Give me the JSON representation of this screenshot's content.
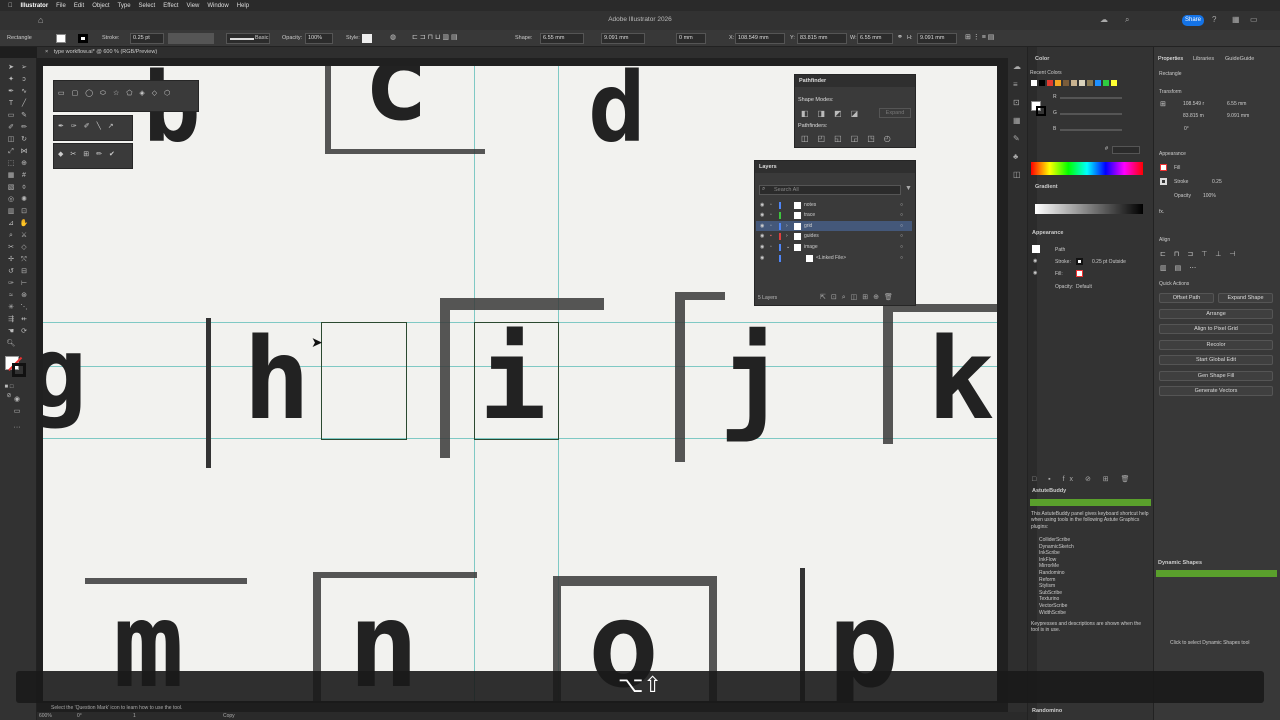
{
  "menubar": {
    "apple": "",
    "items": [
      "Illustrator",
      "File",
      "Edit",
      "Object",
      "Type",
      "Select",
      "Effect",
      "View",
      "Window",
      "Help"
    ]
  },
  "window": {
    "title": "Adobe Illustrator 2026",
    "share": "Share"
  },
  "control": {
    "object_type": "Rectangle",
    "stroke_label": "Stroke:",
    "stroke_value": "0.25 pt",
    "brush": "Basic",
    "opacity_label": "Opacity:",
    "opacity_value": "100%",
    "style_label": "Style:",
    "shape_label": "Shape:",
    "shape_w": "6.55 mm",
    "shape_h": "9.091 mm",
    "corner": "0 mm",
    "x_label": "X:",
    "x_value": "108.549 mm",
    "y_label": "Y:",
    "y_value": "83.815 mm",
    "w_label": "W:",
    "w_value": "6.55 mm",
    "h_label": "H:",
    "h_value": "9.091 mm"
  },
  "document_tab": "type workflow.ai* @ 600 % (RGB/Preview)",
  "artboard": {
    "top_row": [
      "b",
      "c",
      "d"
    ],
    "mid_row": [
      "g",
      "h",
      "i",
      "j",
      "k"
    ],
    "bottom_row": [
      "m",
      "n",
      "o",
      "p"
    ]
  },
  "pathfinder": {
    "title": "Pathfinder",
    "shape_modes": "Shape Modes:",
    "expand": "Expand",
    "pathfinders": "Pathfinders:"
  },
  "layers": {
    "title": "Layers",
    "search_placeholder": "Search All",
    "rows": [
      "notes",
      "trace",
      "grid",
      "guides",
      "image",
      "<Linked File>"
    ],
    "row_colors": [
      "#4f86f7",
      "#3ec53e",
      "#4f86f7",
      "#e04040",
      "#4f86f7",
      "#4f86f7"
    ],
    "footer": "5 Layers"
  },
  "color_panel": {
    "title": "Color",
    "recent": "Recent Colors",
    "channels": [
      "R",
      "G",
      "B"
    ],
    "hex_label": "#",
    "swatches": [
      "#ffffff",
      "#000000",
      "#e23b2e",
      "#f5a623",
      "#7a5c3a",
      "#c8b28f",
      "#d9d2bb",
      "#8a7a52",
      "#1e90ff",
      "#2ecc40",
      "#ffff33"
    ]
  },
  "gradient_panel": {
    "title": "Gradient"
  },
  "appearance_panel": {
    "title": "Appearance",
    "object": "Path",
    "stroke_label": "Stroke:",
    "stroke_value": "0.25 pt  Outside",
    "fill_label": "Fill:",
    "opacity_label": "Opacity:",
    "opacity_value": "Default"
  },
  "astutebuddy": {
    "title": "AstuteBuddy",
    "intro": "This AstuteBuddy panel gives keyboard shortcut help when using tools in the following Astute Graphics plugins:",
    "plugins": [
      "ColliderScribe",
      "DynamicSketch",
      "InkScribe",
      "InkFlow",
      "MirrorMe",
      "Randomino",
      "Reform",
      "Stylism",
      "SubScribe",
      "Texturino",
      "VectorScribe",
      "WidthScribe"
    ],
    "footer": "Keypresses and descriptions are shown when the tool is in use."
  },
  "randomino": {
    "title": "Randomino"
  },
  "properties": {
    "tabs": [
      "Properties",
      "Libraries",
      "GuideGuide"
    ],
    "object": "Rectangle",
    "transform_title": "Transform",
    "x": "108.549 r",
    "y": "83.815 m",
    "w": "6.55 mm",
    "h": "9.091 mm",
    "angle": "0°",
    "appearance_title": "Appearance",
    "fill_label": "Fill",
    "stroke_label": "Stroke",
    "stroke_value": "0.25",
    "opacity_label": "Opacity",
    "opacity_value": "100%",
    "fx": "fx.",
    "align_title": "Align",
    "quick_title": "Quick Actions",
    "buttons_pair": [
      "Offset Path",
      "Expand Shape"
    ],
    "buttons": [
      "Arrange",
      "Align to Pixel Grid",
      "Recolor",
      "Start Global Edit",
      "Gen Shape Fill",
      "Generate Vectors"
    ]
  },
  "dynamic_shapes": {
    "title": "Dynamic Shapes",
    "hint": "Click to select Dynamic Shapes tool"
  },
  "status": {
    "zoom": "600%",
    "rotation": "0°",
    "artboard": "1",
    "tip": "Select the 'Question Mark' icon to learn how to use the tool.",
    "mode": "Copy"
  },
  "keys_overlay": "⌥⇧"
}
